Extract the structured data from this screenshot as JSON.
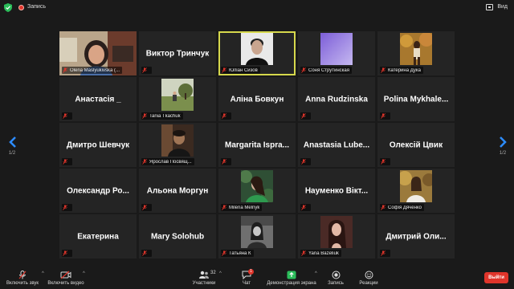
{
  "topbar": {
    "recording_label": "Запись",
    "view_label": "Вид"
  },
  "pagination": {
    "left": "1/2",
    "right": "1/2"
  },
  "tiles": [
    {
      "name": "",
      "label": "Olena Maslyukivska (...",
      "video": "woman-office"
    },
    {
      "name": "Виктор Тринчук",
      "label": "",
      "video": ""
    },
    {
      "name": "",
      "label": "Юліан Сизов",
      "video": "young-man-bw",
      "active": true
    },
    {
      "name": "",
      "label": "Соня Струтинская",
      "video": "purple-gradient"
    },
    {
      "name": "",
      "label": "Катерина Дука",
      "video": "autumn-girl"
    },
    {
      "name": "Анастасія _",
      "label": "",
      "video": ""
    },
    {
      "name": "",
      "label": "Tania Tkachuk",
      "video": "field-photo"
    },
    {
      "name": "Аліна Бовкун",
      "label": "",
      "video": ""
    },
    {
      "name": "Anna Rudzinska",
      "label": "",
      "video": ""
    },
    {
      "name": "Polina Mykhale...",
      "label": "",
      "video": ""
    },
    {
      "name": "Дмитро Шевчук",
      "label": "",
      "video": ""
    },
    {
      "name": "",
      "label": "Ярослав Посвящ...",
      "video": "man-dark"
    },
    {
      "name": "Margarita Ispra...",
      "label": "",
      "video": ""
    },
    {
      "name": "Anastasia Lube...",
      "label": "",
      "video": ""
    },
    {
      "name": "Олексій Цвик",
      "label": "",
      "video": ""
    },
    {
      "name": "Олександр Ро...",
      "label": "",
      "video": ""
    },
    {
      "name": "Альона Моргун",
      "label": "",
      "video": ""
    },
    {
      "name": "",
      "label": "Milena Melnyk",
      "video": "green-girl"
    },
    {
      "name": "Науменко Вікт...",
      "label": "",
      "video": ""
    },
    {
      "name": "",
      "label": "Софія Дяченко",
      "video": "forest-girl"
    },
    {
      "name": "Екатерина",
      "label": "",
      "video": ""
    },
    {
      "name": "Mary Solohub",
      "label": "",
      "video": ""
    },
    {
      "name": "",
      "label": "Татьяна К",
      "video": "bw-portrait"
    },
    {
      "name": "",
      "label": "Yana Bazeliuk",
      "video": "brunette"
    },
    {
      "name": "Дмитрий Оли...",
      "label": "",
      "video": ""
    }
  ],
  "toolbar": {
    "audio": "Включить звук",
    "video": "Включить видео",
    "participants": "Участники",
    "participants_count": "32",
    "chat": "Чат",
    "chat_badge": "1",
    "share": "Демонстрация экрана",
    "record": "Запись",
    "reactions": "Реакции",
    "leave": "Выйти"
  },
  "colors": {
    "background": "#1a1a1a",
    "tile": "#242424",
    "active_border": "#d6d84c",
    "share_green": "#2bbd5a",
    "leave_red": "#e0352b",
    "nav_blue": "#2d8cff"
  }
}
